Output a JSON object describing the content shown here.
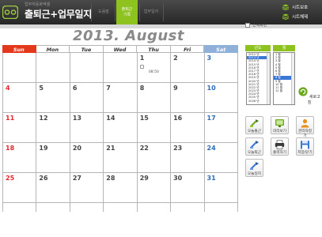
{
  "header": {
    "subtitle": "업무자동화엑셀",
    "title": "출퇴근+업무일지",
    "nav": [
      {
        "label": "도움말"
      },
      {
        "line1": "출퇴근",
        "line2": "기록"
      },
      {
        "label": "업무일지"
      }
    ],
    "buttons": [
      "시트보호",
      "시트해제"
    ]
  },
  "calendar": {
    "month_title": "2013. August",
    "weekdays": [
      "Sun",
      "Mon",
      "Tue",
      "Wed",
      "Thu",
      "Fri",
      "Sat"
    ],
    "weeks": [
      [
        {
          "d": ""
        },
        {
          "d": ""
        },
        {
          "d": ""
        },
        {
          "d": ""
        },
        {
          "d": "1",
          "note": "08:50"
        },
        {
          "d": "2"
        },
        {
          "d": "3"
        }
      ],
      [
        {
          "d": "4"
        },
        {
          "d": "5"
        },
        {
          "d": "6"
        },
        {
          "d": "7"
        },
        {
          "d": "8"
        },
        {
          "d": "9"
        },
        {
          "d": "10"
        }
      ],
      [
        {
          "d": "11"
        },
        {
          "d": "12"
        },
        {
          "d": "13"
        },
        {
          "d": "14"
        },
        {
          "d": "15"
        },
        {
          "d": "16"
        },
        {
          "d": "17"
        }
      ],
      [
        {
          "d": "18"
        },
        {
          "d": "19"
        },
        {
          "d": "20"
        },
        {
          "d": "21"
        },
        {
          "d": "22"
        },
        {
          "d": "23"
        },
        {
          "d": "24"
        }
      ],
      [
        {
          "d": "25"
        },
        {
          "d": "26"
        },
        {
          "d": "27"
        },
        {
          "d": "28"
        },
        {
          "d": "29"
        },
        {
          "d": "30"
        },
        {
          "d": "31"
        }
      ]
    ]
  },
  "panel": {
    "fullscreen_label": "전체화면",
    "year_header": "년도",
    "month_header": "월",
    "years": [
      "2012 년",
      "2013 년",
      "2014 년",
      "2015 년",
      "2016 년",
      "2017 년",
      "2018 년",
      "2019 년",
      "2020 년",
      "2021 년",
      "2022 년",
      "2023 년",
      "2024 년",
      "2025 년",
      "2026 년"
    ],
    "year_selected_index": 1,
    "months": [
      "1 월",
      "2 월",
      "3 월",
      "4 월",
      "5 월",
      "6 월",
      "7 월",
      "8 월",
      "9 월",
      "10 월",
      "11 월",
      "12 월"
    ],
    "month_selected_index": 7,
    "refresh_label": "새로고침",
    "actions": [
      {
        "label": "오늘출근",
        "icon": "check-in-icon"
      },
      {
        "label": "미리보기",
        "icon": "monitor-icon"
      },
      {
        "label": "관리자정기",
        "icon": "user-icon"
      },
      {
        "label": "오늘퇴근",
        "icon": "check-out-icon"
      },
      {
        "label": "출력하기",
        "icon": "printer-icon"
      },
      {
        "label": "저장/닫기",
        "icon": "save-icon"
      },
      {
        "label": "오늘일지",
        "icon": "journal-icon"
      }
    ]
  }
}
